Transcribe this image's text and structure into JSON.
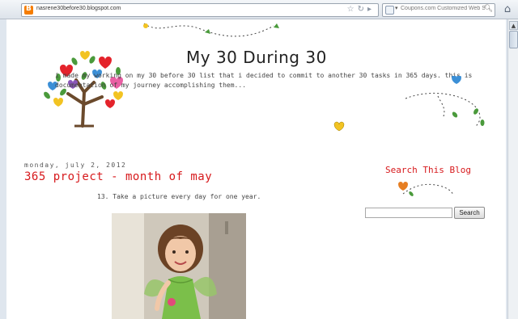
{
  "browser": {
    "url": "nasrene30before30.blogspot.com",
    "search_placeholder": "Coupons.com Customized Web Sea"
  },
  "header": {
    "title": "My 30 During 30",
    "description": "i made my working on my 30 before 30 list that i decided to commit to another 30 tasks in 365 days. this is documentation of my journey accomplishing them..."
  },
  "post": {
    "date": "monday, july 2, 2012",
    "title": "365 project - month of may",
    "body": "13. Take a picture every day for one year."
  },
  "sidebar": {
    "search_title": "Search This Blog",
    "search_button": "Search"
  },
  "colors": {
    "accent": "#d7191c"
  }
}
